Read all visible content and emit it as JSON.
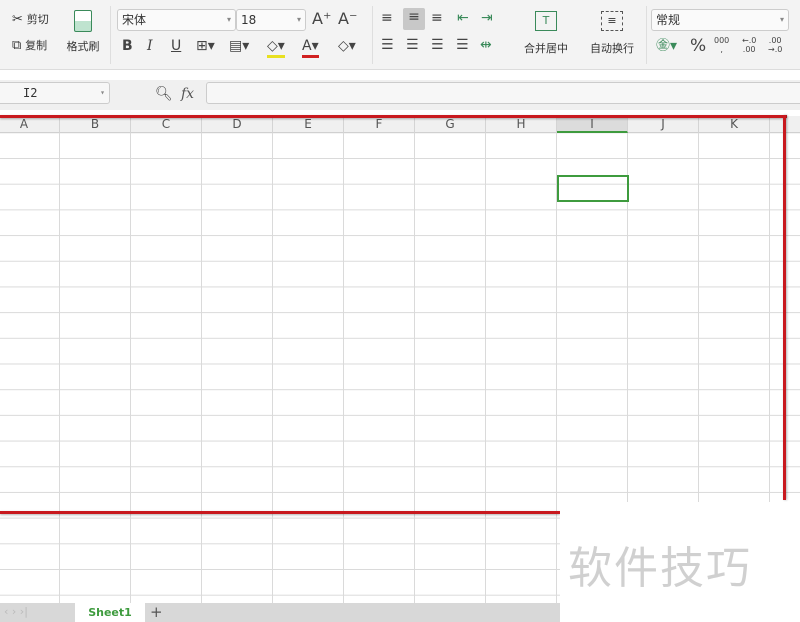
{
  "ribbon": {
    "cut": "剪切",
    "copy": "复制",
    "format_painter": "格式刷",
    "font_name": "宋体",
    "font_size": "18",
    "merge_center": "合并居中",
    "wrap_text": "自动换行",
    "number_format": "常规"
  },
  "formula_bar": {
    "cell_ref": "I2",
    "fx": "fx",
    "value": ""
  },
  "columns": [
    "A",
    "B",
    "C",
    "D",
    "E",
    "F",
    "G",
    "H",
    "I",
    "J",
    "K"
  ],
  "selected_cell": "I2",
  "sheets": [
    {
      "name": "Sheet1",
      "active": true
    }
  ],
  "watermark": "软件技巧",
  "colors": {
    "accent": "#3e9b3e",
    "annotation": "#c8191e"
  }
}
